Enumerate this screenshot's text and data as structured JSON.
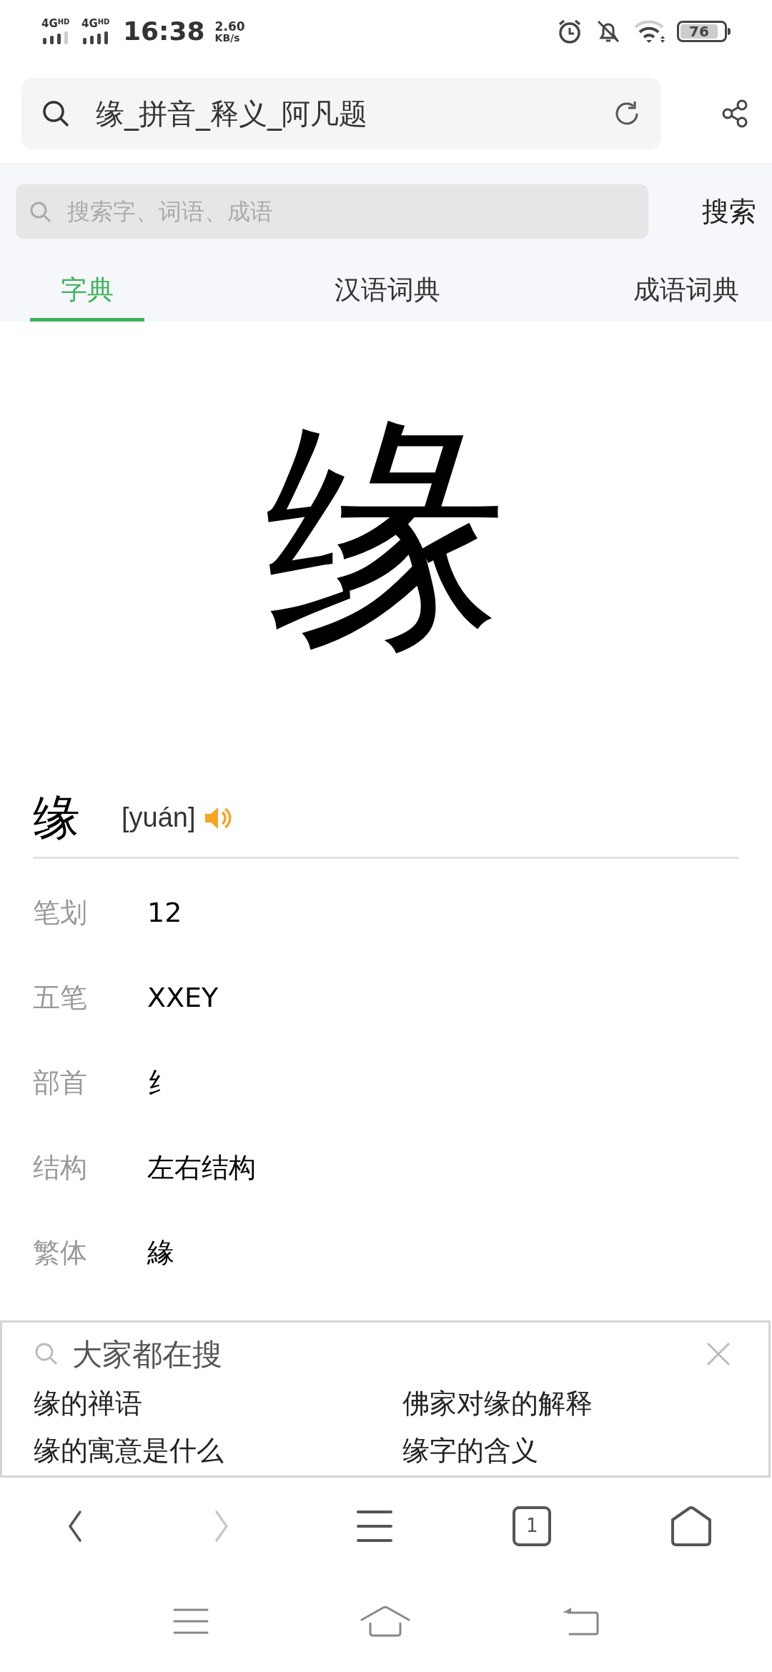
{
  "status_bar": {
    "signal_1": "4G",
    "signal_1_badge": "HD",
    "signal_2": "4G",
    "signal_2_badge": "HD",
    "time": "16:38",
    "speed": "2.60",
    "speed_unit": "KB/s",
    "battery": "76"
  },
  "address_bar": {
    "title": "缘_拼音_释义_阿凡题"
  },
  "search": {
    "placeholder": "搜索字、词语、成语",
    "button": "搜索"
  },
  "tabs": [
    {
      "label": "字典",
      "selected": true
    },
    {
      "label": "汉语词典",
      "selected": false
    },
    {
      "label": "成语词典",
      "selected": false
    }
  ],
  "character": "缘",
  "entry": {
    "character": "缘",
    "pinyin": "[yuán]"
  },
  "details": [
    {
      "label": "笔划",
      "value": "12"
    },
    {
      "label": "五笔",
      "value": "XXEY"
    },
    {
      "label": "部首",
      "value": "纟"
    },
    {
      "label": "结构",
      "value": "左右结构"
    },
    {
      "label": "繁体",
      "value": "緣"
    }
  ],
  "popular_searches": {
    "title": "大家都在搜",
    "items": [
      "缘的禅语",
      "佛家对缘的解释",
      "缘的寓意是什么",
      "缘字的含义"
    ]
  },
  "browser_toolbar": {
    "tab_count": "1",
    "forward_disabled": true
  }
}
